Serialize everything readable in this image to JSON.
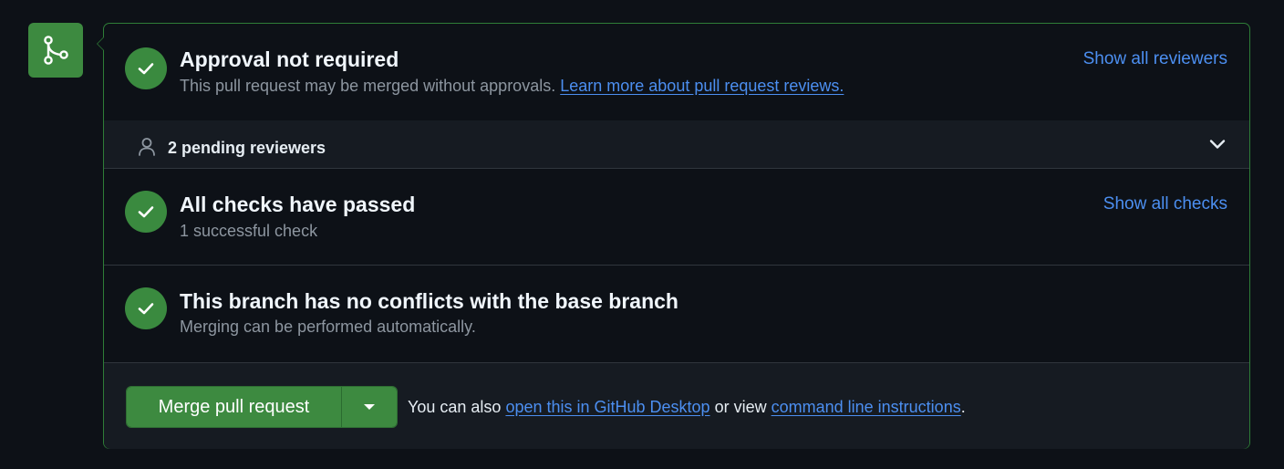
{
  "approval": {
    "title": "Approval not required",
    "description": "This pull request may be merged without approvals.",
    "learn_more_link": "Learn more about pull request reviews.",
    "show_reviewers_link": "Show all reviewers"
  },
  "reviewers": {
    "label": "2 pending reviewers"
  },
  "checks": {
    "title": "All checks have passed",
    "description": "1 successful check",
    "show_checks_link": "Show all checks"
  },
  "conflicts": {
    "title": "This branch has no conflicts with the base branch",
    "description": "Merging can be performed automatically."
  },
  "merge": {
    "button_label": "Merge pull request",
    "note_prefix": "You can also",
    "desktop_link": "open this in GitHub Desktop",
    "note_middle": "or view",
    "cli_link": "command line instructions",
    "note_suffix": "."
  },
  "colors": {
    "success": "#3d8a40",
    "link": "#4c8ff1",
    "background": "#0d1117",
    "panel_alt": "#161b22"
  },
  "icons": {
    "badge": "git-merge-icon",
    "status": "check-icon",
    "reviewer": "person-icon",
    "expand": "chevron-down-icon",
    "dropdown": "triangle-down-icon"
  }
}
